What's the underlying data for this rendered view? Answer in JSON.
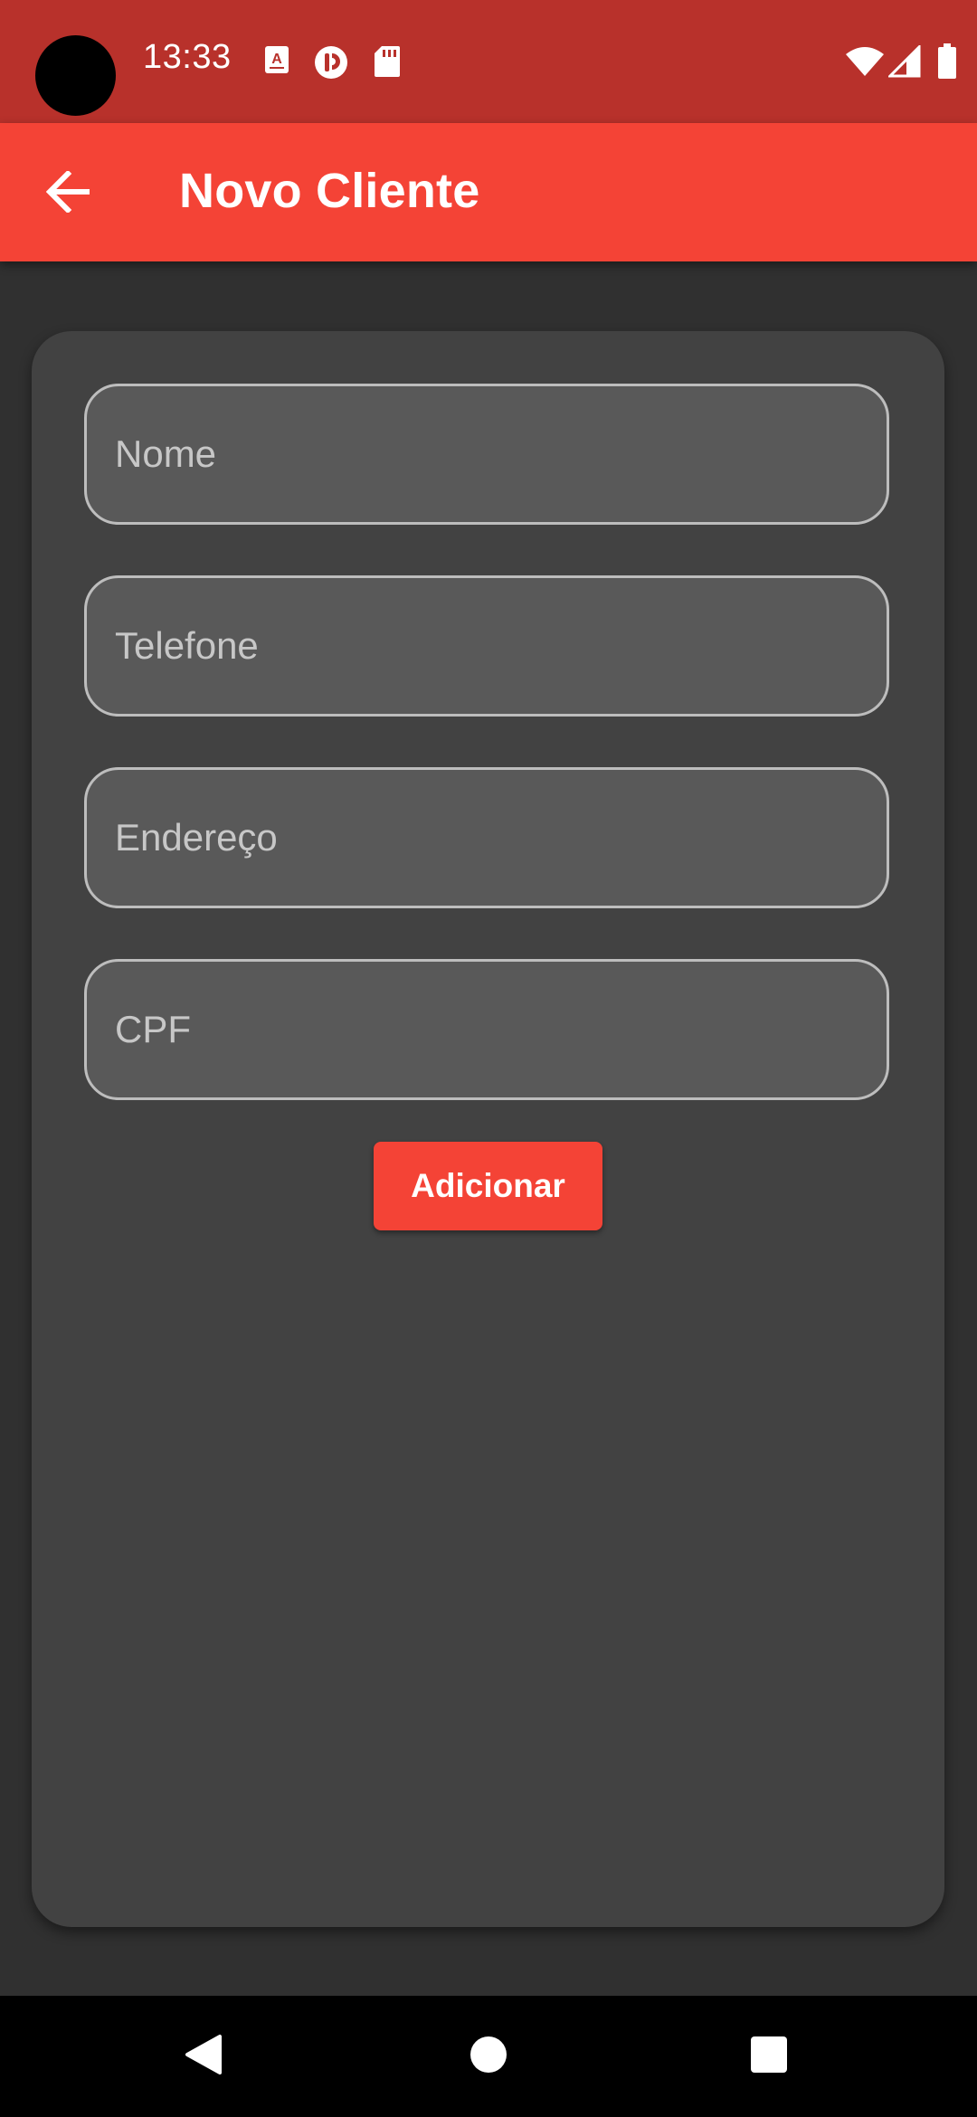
{
  "status_bar": {
    "time": "13:33",
    "notification_icons": [
      "text-a-icon",
      "pocket-casts-icon",
      "sd-card-icon"
    ],
    "system_icons": [
      "wifi-icon",
      "cellular-signal-icon",
      "battery-icon"
    ],
    "background_color": "#B8312B"
  },
  "app_bar": {
    "title": "Novo Cliente",
    "back_icon": "arrow-back-icon",
    "background_color": "#F44336"
  },
  "form": {
    "fields": [
      {
        "placeholder": "Nome",
        "value": ""
      },
      {
        "placeholder": "Telefone",
        "value": ""
      },
      {
        "placeholder": "Endereço",
        "value": ""
      },
      {
        "placeholder": "CPF",
        "value": ""
      }
    ],
    "submit_label": "Adicionar",
    "accent_color": "#F44336"
  },
  "nav_bar": {
    "buttons": [
      "back-triangle-icon",
      "home-circle-icon",
      "recents-square-icon"
    ]
  }
}
